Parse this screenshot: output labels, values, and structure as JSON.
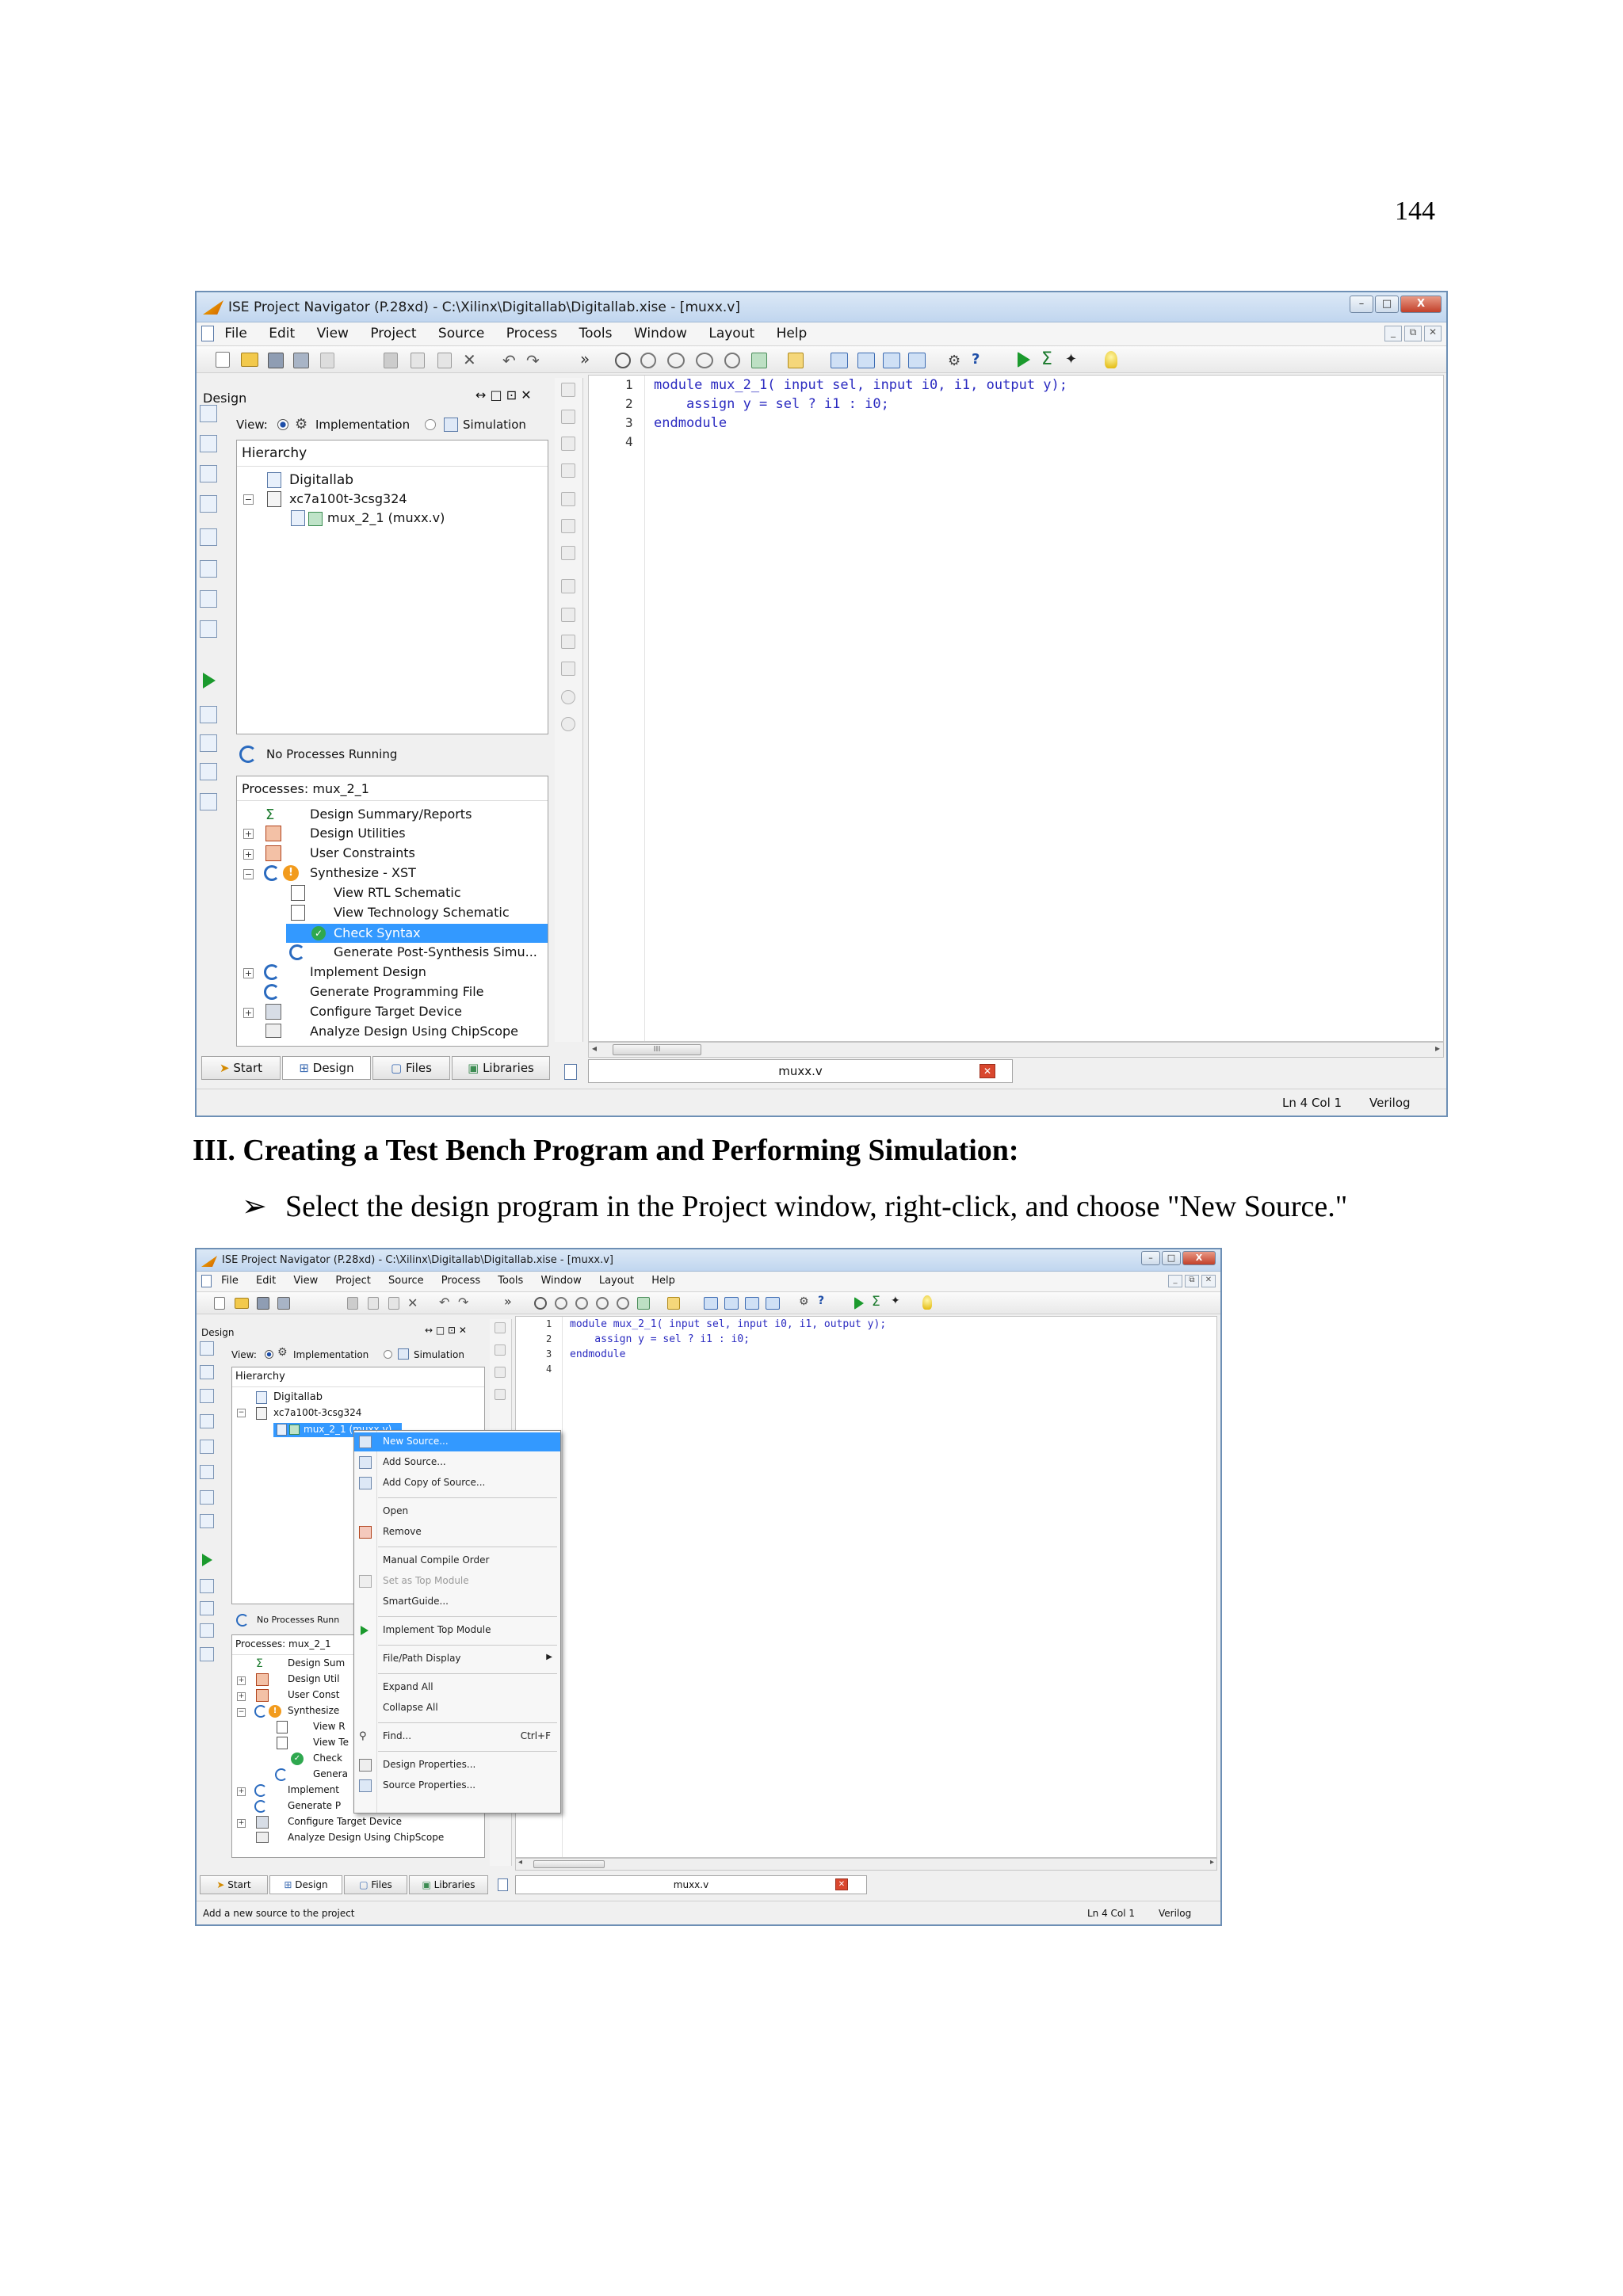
{
  "page": {
    "number": "144",
    "section_heading": "III. Creating a Test Bench Program and Performing Simulation:",
    "bullet_marker": "➢",
    "bullet_text": "Select the design program in the Project window, right-click, and choose \"New Source.\""
  },
  "screenshot1": {
    "window_title": "ISE Project Navigator (P.28xd) - C:\\Xilinx\\Digitallab\\Digitallab.xise - [muxx.v]",
    "window_buttons": [
      "–",
      "□",
      "X"
    ],
    "menu": [
      "File",
      "Edit",
      "View",
      "Project",
      "Source",
      "Process",
      "Tools",
      "Window",
      "Layout",
      "Help"
    ],
    "toolbar_overflow": "»",
    "design_panel": {
      "title": "Design",
      "panel_buttons": "↔ □ ⊡ ✕",
      "view_label": "View:",
      "implementation": "Implementation",
      "simulation": "Simulation",
      "hierarchy_label": "Hierarchy",
      "tree": [
        "Digitallab",
        "xc7a100t-3csg324",
        "mux_2_1 (muxx.v)"
      ],
      "no_processes": "No Processes Running",
      "processes_label": "Processes: mux_2_1",
      "processes": [
        "Design Summary/Reports",
        "Design Utilities",
        "User Constraints",
        "Synthesize - XST",
        "View RTL Schematic",
        "View Technology Schematic",
        "Check Syntax",
        "Generate Post-Synthesis Simu...",
        "Implement Design",
        "Generate Programming File",
        "Configure Target Device",
        "Analyze Design Using ChipScope"
      ]
    },
    "editor": {
      "line_numbers": [
        "1",
        "2",
        "3",
        "4"
      ],
      "code_lines": [
        "module mux_2_1( input sel, input i0, i1, output y);",
        "    assign y = sel ? i1 : i0;",
        "endmodule",
        ""
      ],
      "scroll_marker": "III"
    },
    "tabs": [
      "Start",
      "Design",
      "Files",
      "Libraries"
    ],
    "editor_tab": "muxx.v",
    "status_position": "Ln 4 Col 1",
    "status_language": "Verilog"
  },
  "screenshot2": {
    "window_title": "ISE Project Navigator (P.28xd) - C:\\Xilinx\\Digitallab\\Digitallab.xise - [muxx.v]",
    "window_buttons": [
      "–",
      "□",
      "X"
    ],
    "menu": [
      "File",
      "Edit",
      "View",
      "Project",
      "Source",
      "Process",
      "Tools",
      "Window",
      "Layout",
      "Help"
    ],
    "design_panel": {
      "title": "Design",
      "panel_buttons": "↔ □ ⊡ ✕",
      "view_label": "View:",
      "implementation": "Implementation",
      "simulation": "Simulation",
      "hierarchy_label": "Hierarchy",
      "tree": [
        "Digitallab",
        "xc7a100t-3csg324",
        "mux_2_1 (muxx.v)"
      ],
      "no_processes": "No Processes Runn",
      "processes_label": "Processes: mux_2_1",
      "processes": [
        "Design Sum",
        "Design Util",
        "User Const",
        "Synthesize",
        "View R",
        "View Te",
        "Check",
        "Genera",
        "Implement",
        "Generate P",
        "Configure Target Device",
        "Analyze Design Using ChipScope"
      ]
    },
    "context_menu": {
      "new_source": "New Source...",
      "add_source": "Add Source...",
      "add_copy": "Add Copy of Source...",
      "open": "Open",
      "remove": "Remove",
      "manual_compile": "Manual Compile Order",
      "set_top": "Set as Top Module",
      "smartguide": "SmartGuide...",
      "implement_top": "Implement Top Module",
      "file_path": "File/Path Display",
      "expand_all": "Expand All",
      "collapse_all": "Collapse All",
      "find": "Find...",
      "find_shortcut": "Ctrl+F",
      "design_properties": "Design Properties...",
      "source_properties": "Source Properties..."
    },
    "editor": {
      "line_numbers": [
        "1",
        "2",
        "3",
        "4"
      ],
      "code_lines": [
        "module mux_2_1( input sel, input i0, i1, output y);",
        "    assign y = sel ? i1 : i0;",
        "endmodule",
        ""
      ]
    },
    "tabs": [
      "Start",
      "Design",
      "Files",
      "Libraries"
    ],
    "editor_tab": "muxx.v",
    "status_message": "Add a new source to the project",
    "status_position": "Ln 4 Col 1",
    "status_language": "Verilog"
  },
  "colors": {
    "selection": "#3399ff",
    "code_blue": "#2a2ac0",
    "keyword_purple": "#7a3fb8",
    "window_border": "#6d8fb5",
    "close_red": "#c2402a"
  }
}
